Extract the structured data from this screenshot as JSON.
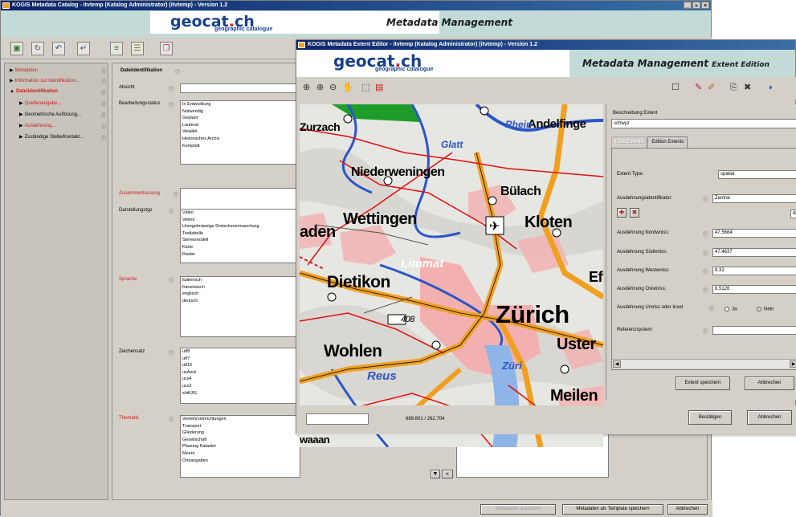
{
  "main": {
    "title": "KOGIS Metadata Catalog - itvtemp (Katalog Administrator) (itvtemp) - Version 1.2",
    "window_buttons": [
      "_",
      "»",
      "×"
    ],
    "logo": {
      "pre": "geocat",
      "dot": ".",
      "post": "ch",
      "sub": "geographic catalogue"
    },
    "banner_title": "Metadata Management",
    "toolbar_glyphs": [
      "▣",
      "↻",
      "↶",
      "↵",
      "≡",
      "☰",
      "❒"
    ],
    "nav": [
      {
        "label": "Metadaten",
        "arrow": "▶",
        "red": true
      },
      {
        "label": "Information zur Identifikation...",
        "arrow": "▶",
        "red": true
      },
      {
        "label": "Dateiidentifikation",
        "arrow": "▲",
        "red": true
      },
      {
        "label": "Quellenangabe...",
        "arrow": "▶",
        "red": true
      },
      {
        "label": "Geometrische Auflösung...",
        "arrow": "▶",
        "red": false
      },
      {
        "label": "Ausdehnung...",
        "arrow": "▶",
        "red": true
      },
      {
        "label": "Zuständige Stelle/Kontakt...",
        "arrow": "▶",
        "red": false
      }
    ],
    "info_glyph": "ⓘ",
    "section_title": "Dateiidentifikation",
    "fields": {
      "absicht": "Absicht",
      "bearbeitungsstatus": "Bearbeitungsstatus",
      "zusammenfassung": "Zusammenfassung",
      "darstellungstyp": "Darstellungstyp",
      "sprache": "Sprache",
      "zeichensatz": "Zeichensatz",
      "thematik": "Thematik"
    },
    "status_options": [
      "In Entwicklung",
      "Notwendig",
      "Geplant",
      "Laufend",
      "Veraltet",
      "Historisches Archiv",
      "Komplett"
    ],
    "darstellung_options": [
      "Video",
      "Vektor",
      "Unregelmässige Dreiecksvermaschung",
      "Textlabelle",
      "Stereomodell",
      "Karte",
      "Raster"
    ],
    "sprache_options": [
      "italienisch",
      "französisch",
      "englisch",
      "deutsch"
    ],
    "zeichensatz_options": [
      "utf8",
      "utf7",
      "utf16",
      "usAscii",
      "ucs4",
      "ucs2",
      "shiftJIS"
    ],
    "thematik_options": [
      "Verkehrseinrichtungen",
      "Transport",
      "Gliederung",
      "Gesellschaft",
      "Planung Kataster",
      "Meere",
      "Ortsangaben"
    ],
    "footer_buttons": {
      "save": "Metadaten speichern",
      "template": "Metadaten als Template speichern",
      "cancel": "Abbrechen"
    }
  },
  "extent": {
    "title": "KOGIS Metadata Extent Editor - itvtemp (Katalog Administrator) (itvtemp) - Version 1.2",
    "banner_title": "Metadata Management",
    "banner_subtitle": "Extent Edition",
    "map_tool_glyphs": [
      "⊕",
      "⊕",
      "⊖",
      "✋",
      "⬚",
      "▤"
    ],
    "right_tool_glyphs": [
      "☐",
      "✎",
      "✐",
      "⎘",
      "✖",
      "◑"
    ],
    "beschreibung_label": "Beschreibung Extent",
    "beschreibung_value": "schwyz",
    "tabs": [
      "Liste Extents",
      "Edition Extents"
    ],
    "extent_type_label": "Extent Type:",
    "extent_type_value": "spatial",
    "identifikator_label": "Ausdehnungsidentifikator:",
    "identifikator_value": "Zentral",
    "identifikator_extra": "de",
    "nord_label": "Ausdehnung Nordwniss:",
    "nord_value": "47.5684",
    "sued_label": "Ausdehnung Südwniss:",
    "sued_value": "47.4637",
    "west_label": "Ausdehnung Westwniss:",
    "west_value": "8.32",
    "ost_label": "Ausdehnung Ostwniss:",
    "ost_value": "8.5126",
    "umriss_label": "Ausdehnung Umriss oder Inset",
    "radio_ja": "Ja",
    "radio_nein": "Nein",
    "referenz_label": "Referenzsystem:",
    "save_extent": "Extent speichern",
    "cancel_extent": "Abbrechen",
    "coords": "689.601 / 262.704",
    "confirm": "Bestätigen",
    "cancel": "Abbrechen",
    "map_labels": {
      "zurzach": "Zurzach",
      "andelfingen": "Andelfinge",
      "glatt": "Glatt",
      "rhein": "Rhein",
      "niederweningen": "Niederweningen",
      "buelach": "Bülach",
      "wettingen": "Wettingen",
      "kloten": "Kloten",
      "baden": "aden",
      "limmat": "Limmat",
      "dietikon": "Dietikon",
      "eff": "Eff",
      "road408": "408",
      "zuerich": "Zürich",
      "wohlen": "Wohlen",
      "uster": "Uster",
      "reuss": "Reus",
      "meilen": "Meilen",
      "bremgarten": "waaan",
      "zuri": "Züri"
    },
    "colors": {
      "road_major": "#f0a020",
      "road_minor": "#e01010",
      "water": "#2b56c8",
      "urban": "#f3b0b0",
      "forest": "#1f9b2a"
    }
  }
}
